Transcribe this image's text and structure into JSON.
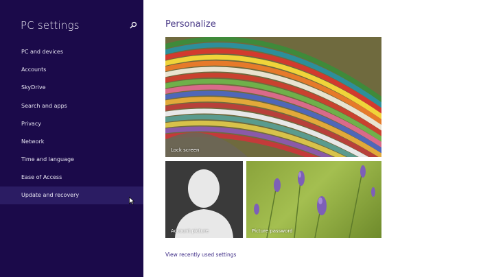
{
  "sidebar": {
    "title": "PC settings",
    "items": [
      {
        "label": "PC and devices"
      },
      {
        "label": "Accounts"
      },
      {
        "label": "SkyDrive"
      },
      {
        "label": "Search and apps"
      },
      {
        "label": "Privacy"
      },
      {
        "label": "Network"
      },
      {
        "label": "Time and language"
      },
      {
        "label": "Ease of Access"
      },
      {
        "label": "Update and recovery",
        "selected": true
      }
    ]
  },
  "main": {
    "title": "Personalize",
    "tiles": {
      "lock_screen": "Lock screen",
      "account_picture": "Account picture",
      "picture_password": "Picture password"
    },
    "recent_link": "View recently used settings"
  },
  "colors": {
    "sidebar_bg": "#1b0a4a",
    "selected_bg": "#2b1c63",
    "title_color": "#4a3a87",
    "link_color": "#3c2a86"
  }
}
